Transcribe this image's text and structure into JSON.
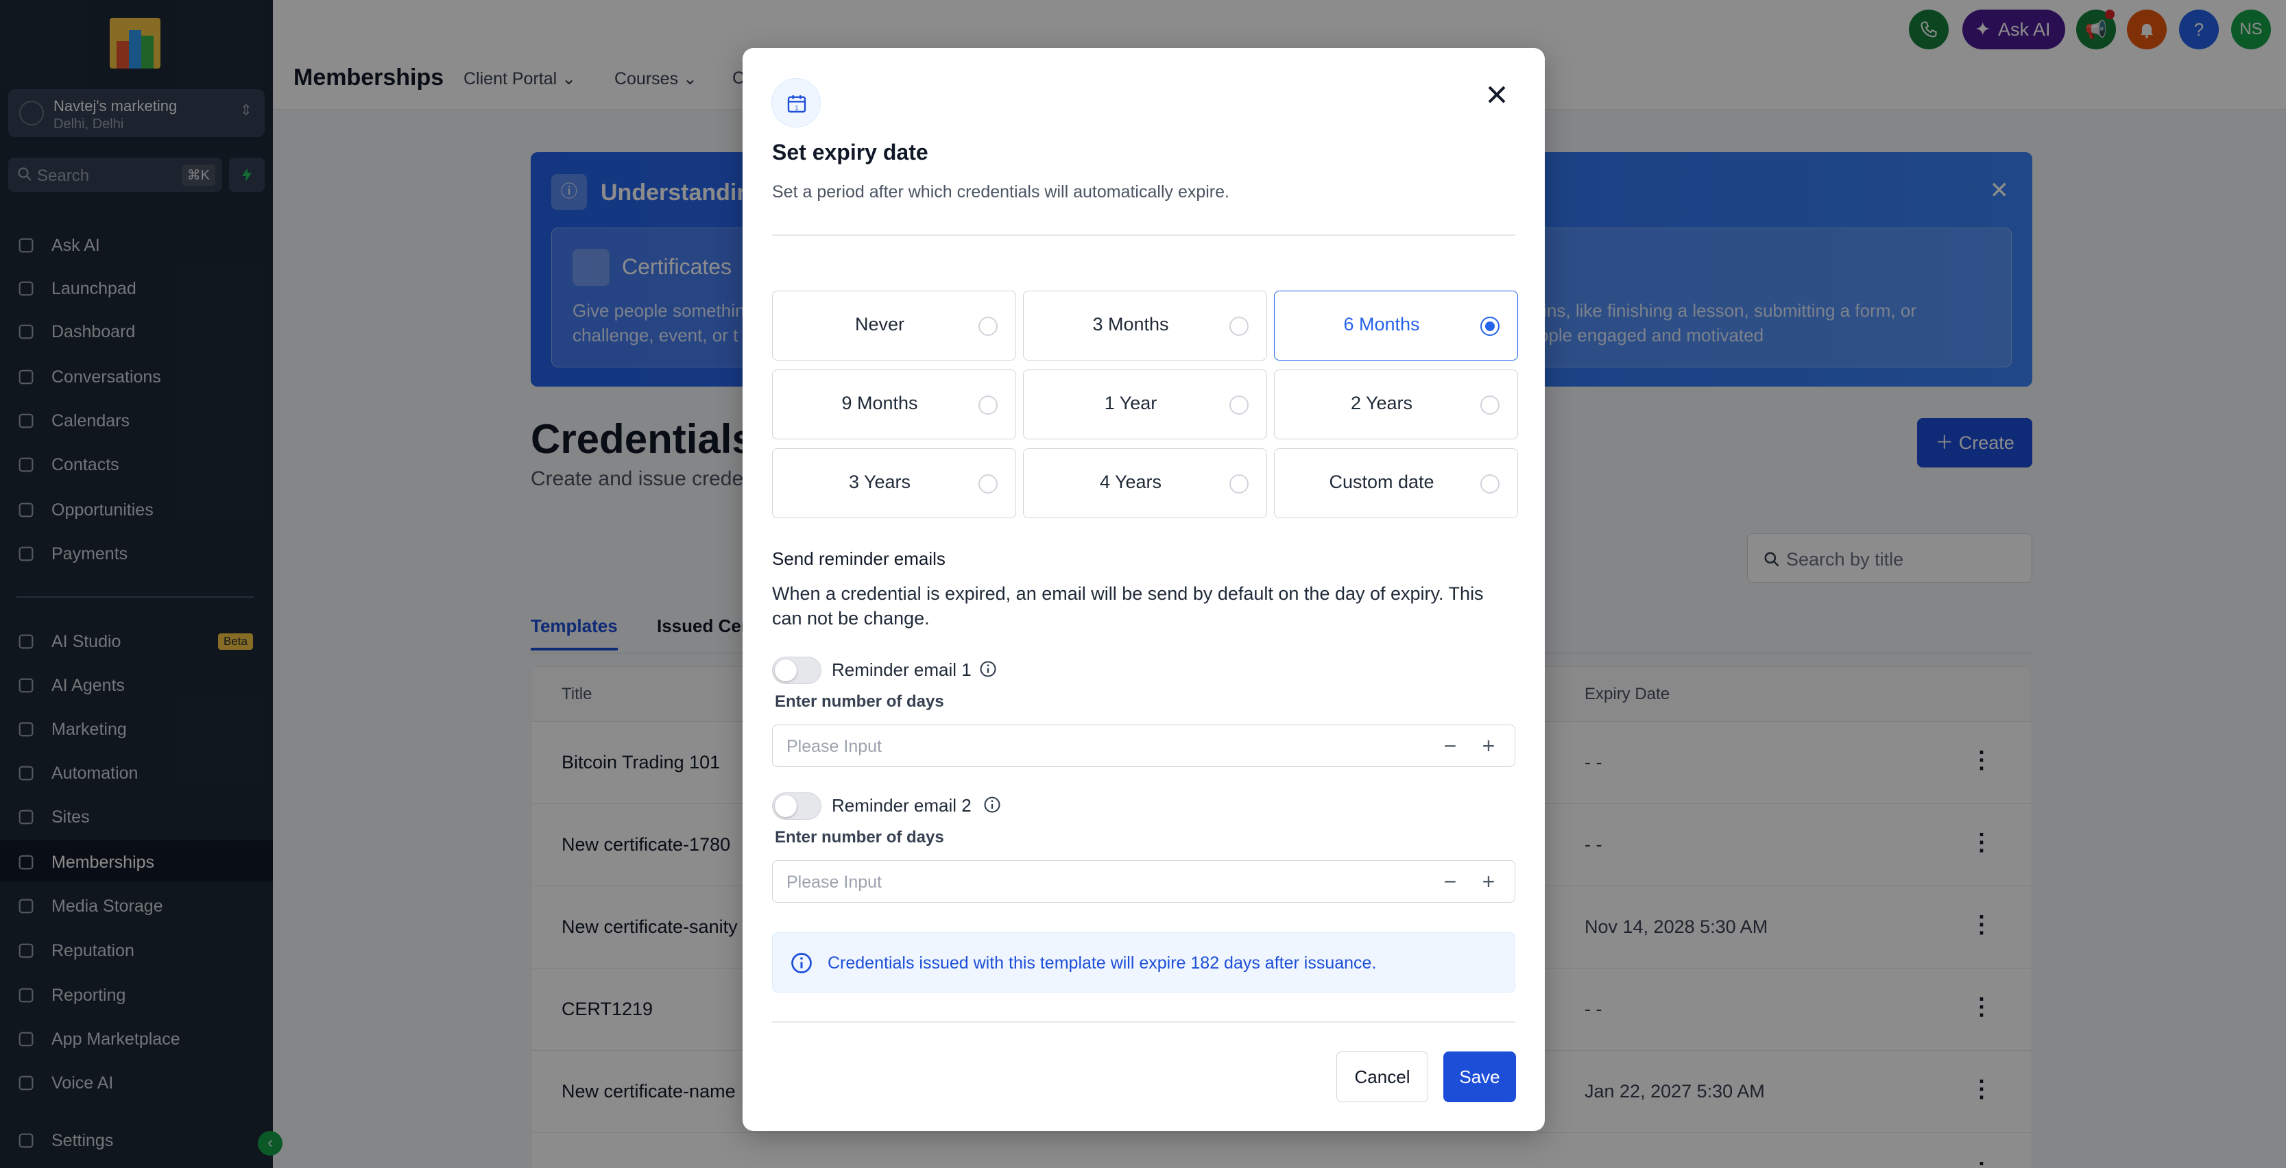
{
  "sidebar": {
    "account": {
      "name": "Navtej's marketing",
      "location": "Delhi, Delhi"
    },
    "search": {
      "placeholder": "Search",
      "shortcut": "⌘K"
    },
    "items": [
      {
        "label": "Ask AI",
        "icon": "sparkle-icon"
      },
      {
        "label": "Launchpad",
        "icon": "rocket-icon"
      },
      {
        "label": "Dashboard",
        "icon": "grid-icon"
      },
      {
        "label": "Conversations",
        "icon": "chat-icon"
      },
      {
        "label": "Calendars",
        "icon": "calendar-icon"
      },
      {
        "label": "Contacts",
        "icon": "contacts-icon"
      },
      {
        "label": "Opportunities",
        "icon": "pipeline-icon"
      },
      {
        "label": "Payments",
        "icon": "receipt-icon"
      },
      {
        "label": "AI Studio",
        "icon": "studio-icon",
        "badge": "Beta"
      },
      {
        "label": "AI Agents",
        "icon": "agent-icon"
      },
      {
        "label": "Marketing",
        "icon": "send-icon"
      },
      {
        "label": "Automation",
        "icon": "automation-icon"
      },
      {
        "label": "Sites",
        "icon": "sites-icon"
      },
      {
        "label": "Memberships",
        "icon": "award-icon",
        "active": true
      },
      {
        "label": "Media Storage",
        "icon": "image-icon"
      },
      {
        "label": "Reputation",
        "icon": "star-icon"
      },
      {
        "label": "Reporting",
        "icon": "trend-icon"
      },
      {
        "label": "App Marketplace",
        "icon": "apps-icon"
      },
      {
        "label": "Voice AI",
        "icon": "phone-icon"
      },
      {
        "label": "Settings",
        "icon": "gear-icon"
      }
    ]
  },
  "topbar": {
    "title": "Memberships",
    "nav": [
      "Client Portal",
      "Courses",
      "C"
    ],
    "ask_ai": "Ask AI",
    "help": "?",
    "avatar": "NS"
  },
  "banner": {
    "title": "Understandin",
    "card1_title": "Certificates",
    "card1_text_1": "Give people somethin",
    "card1_text_2": "challenge, event, or t",
    "card2_text_1": "aller wins, like finishing a lesson, submitting a form, or",
    "card2_text_2": "people engaged and motivated"
  },
  "credentials": {
    "title": "Credentials",
    "subtitle": "Create and issue crede",
    "create_label": "Create",
    "search_placeholder": "Search by title",
    "tabs": [
      "Templates",
      "Issued Cer"
    ],
    "columns": {
      "title": "Title",
      "expiry": "Expiry Date"
    },
    "rows": [
      {
        "title": "Bitcoin Trading 101",
        "expiry": "- -"
      },
      {
        "title": "New certificate-1780",
        "expiry": "- -"
      },
      {
        "title": "New certificate-sanity",
        "expiry": "Nov 14, 2028 5:30 AM"
      },
      {
        "title": "CERT1219",
        "expiry": "- -"
      },
      {
        "title": "New certificate-name",
        "expiry": "Jan 22, 2027 5:30 AM"
      },
      {
        "title": "",
        "expiry": ""
      }
    ]
  },
  "modal": {
    "title": "Set expiry date",
    "subtitle": "Set a period after which credentials will automatically expire.",
    "options": [
      {
        "label": "Never",
        "selected": false
      },
      {
        "label": "3 Months",
        "selected": false
      },
      {
        "label": "6 Months",
        "selected": true
      },
      {
        "label": "9 Months",
        "selected": false
      },
      {
        "label": "1 Year",
        "selected": false
      },
      {
        "label": "2 Years",
        "selected": false
      },
      {
        "label": "3 Years",
        "selected": false
      },
      {
        "label": "4 Years",
        "selected": false
      },
      {
        "label": "Custom date",
        "selected": false
      }
    ],
    "reminder_title": "Send reminder emails",
    "reminder_desc": "When a credential is expired, an email will be send by default on the day of expiry. This can not be change.",
    "reminders": [
      {
        "label": "Reminder email 1",
        "enabled": false,
        "field_label": "Enter number of days",
        "placeholder": "Please Input"
      },
      {
        "label": "Reminder email 2",
        "enabled": false,
        "field_label": "Enter number of days",
        "placeholder": "Please Input"
      }
    ],
    "note": "Credentials issued with this template will expire 182 days after issuance.",
    "cancel_label": "Cancel",
    "save_label": "Save"
  },
  "colors": {
    "primary": "#1d4ed8",
    "sidebar_bg": "#1e2938",
    "accent_green": "#16a34a",
    "ask_ai_bg": "#4c1d95"
  }
}
